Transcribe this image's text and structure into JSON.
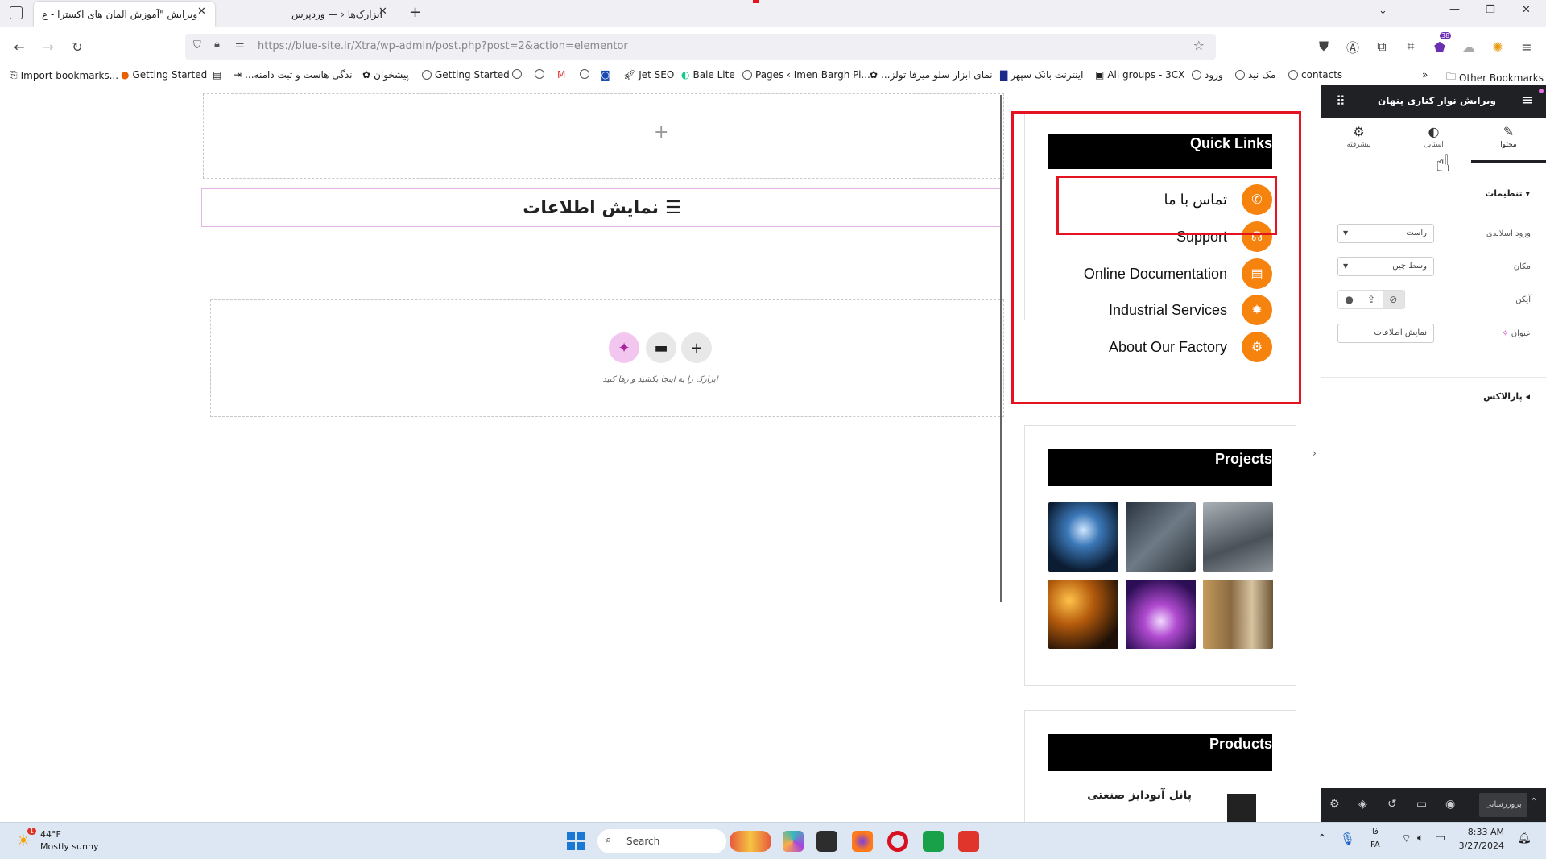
{
  "browser": {
    "tabs": [
      {
        "label": "ویرایش \"آموزش المان های اکسترا - ع"
      },
      {
        "label": "ابزارک‌ها ‹ — وردپرس"
      }
    ],
    "url": "https://blue-site.ir/Xtra/wp-admin/post.php?post=2&action=elementor",
    "extension_badge": "38",
    "bookmarks": [
      "Import bookmarks...",
      "Getting Started",
      "...ندگی هاست و ثبت دامنه",
      "پیشخوان",
      "Getting Started",
      "Jet SEO",
      "Bale Lite",
      "Pages ‹ Imen Bargh Pi...",
      "...نمای ابزار سلو میزفا تولز",
      "اینترنت بانک سپهر",
      "All groups - 3CX",
      "ورود",
      "مک نید",
      "contacts"
    ],
    "other_bookmarks": "Other Bookmarks"
  },
  "canvas": {
    "info_heading": "نمایش اطلاعات",
    "drop_hint": "ابزارک را به اینجا بکشید و رها کنید",
    "quick_links": {
      "title": "Quick Links",
      "items": [
        "تماس با ما",
        "Support",
        "Online Documentation",
        "Industrial Services",
        "About Our Factory"
      ]
    },
    "projects": {
      "title": "Projects"
    },
    "products": {
      "title": "Products",
      "first_item": "پانل آنودایز صنعتی"
    }
  },
  "panel": {
    "title": "ویرایش نوار کناری پنهان",
    "tabs": [
      "محتوا",
      "استایل",
      "پیشرفته"
    ],
    "section_settings": "تنظیمات",
    "fields": {
      "entry_label": "ورود اسلایدی",
      "entry_value": "راست",
      "position_label": "مکان",
      "position_value": "وسط چین",
      "icon_label": "آیکن",
      "title_label": "عنوان",
      "title_value": "نمایش اطلاعات"
    },
    "section_parallax": "پارالاکس",
    "update_button": "بروزرسانی"
  },
  "taskbar": {
    "weather_temp": "44°F",
    "weather_text": "Mostly sunny",
    "weather_badge": "1",
    "search": "Search",
    "lang_top": "فا",
    "lang_bottom": "FA",
    "time": "8:33 AM",
    "date": "3/27/2024"
  }
}
